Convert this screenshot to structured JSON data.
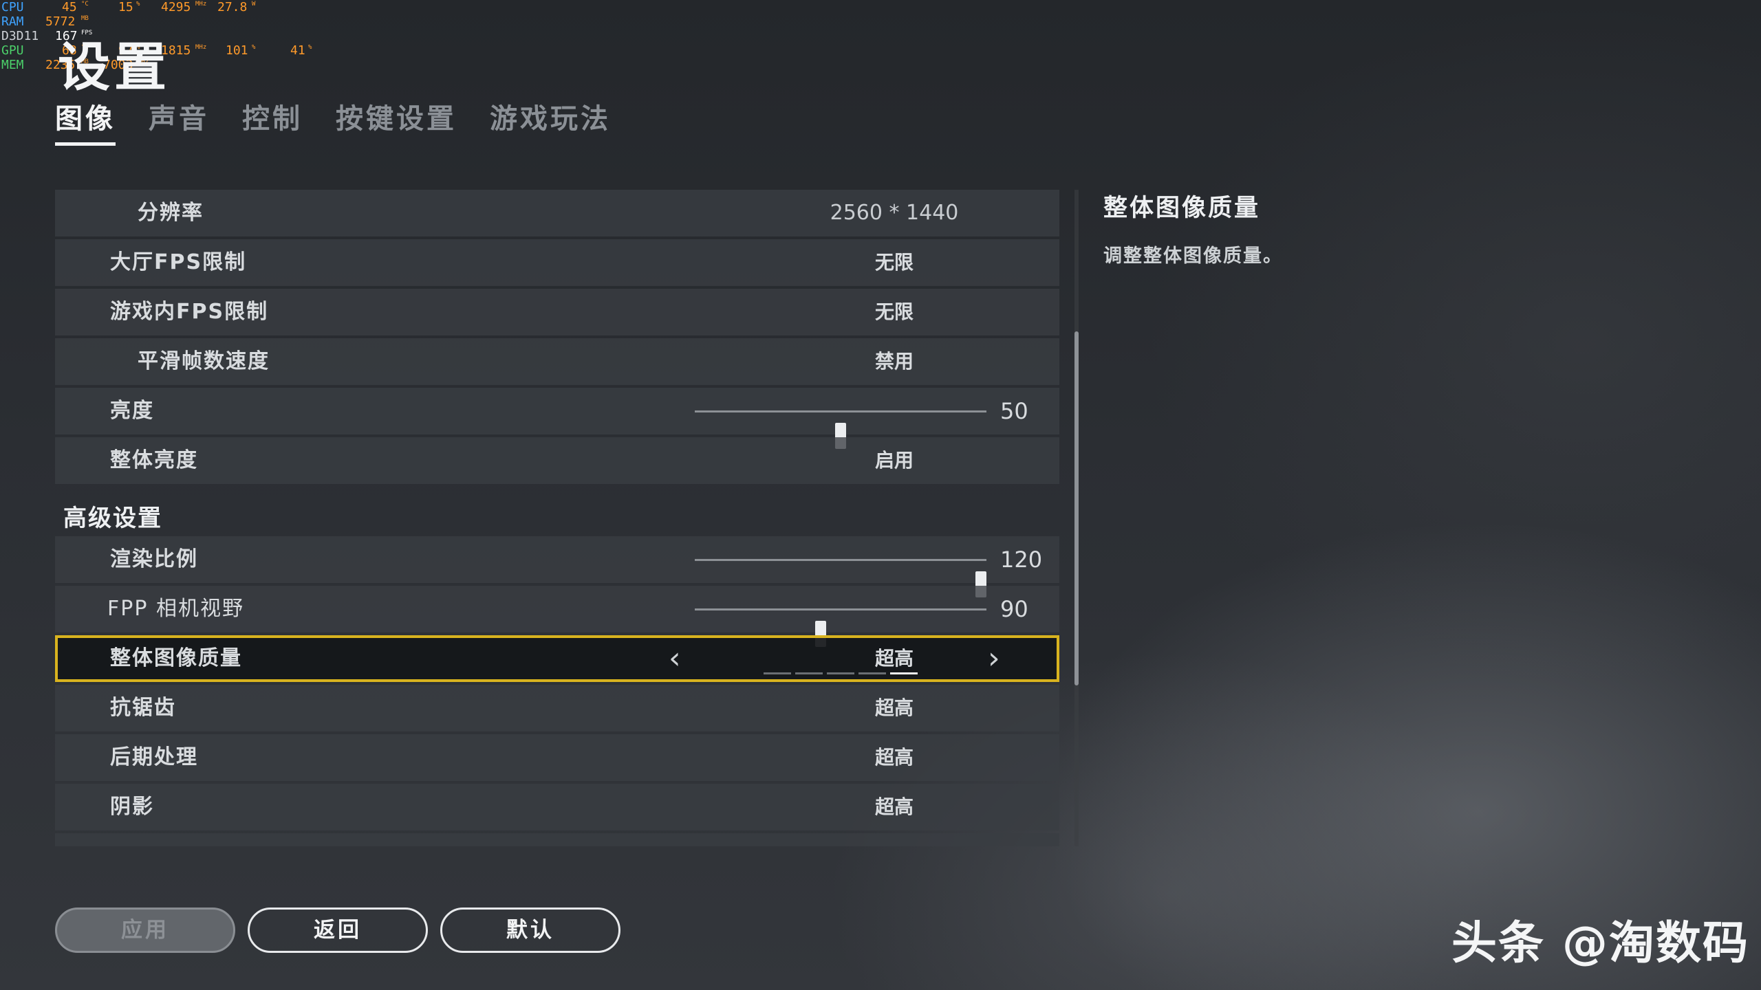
{
  "overlay": {
    "cpu": {
      "label": "CPU",
      "temp": "45",
      "temp_unit": "°C",
      "load": "15",
      "load_unit": "%",
      "clock": "4295",
      "clock_unit": "MHz",
      "power": "27.8",
      "power_unit": "W"
    },
    "ram": {
      "label": "RAM",
      "used": "5772",
      "used_unit": "MB"
    },
    "d3d": {
      "label": "D3D11",
      "fps": "167",
      "fps_unit": "FPS"
    },
    "gpu": {
      "label": "GPU",
      "temp": "68",
      "temp_unit": "°C",
      "load": "97",
      "load_unit": "%",
      "clock": "1815",
      "clock_unit": "MHz",
      "power": "101",
      "power_unit": "%",
      "fan": "41",
      "fan_unit": "%"
    },
    "mem": {
      "label": "MEM",
      "used": "2235",
      "used_unit": "MB",
      "clock": "7003",
      "clock_unit": "MHz"
    }
  },
  "page": {
    "title": "设置"
  },
  "tabs": [
    {
      "label": "图像",
      "active": true
    },
    {
      "label": "声音",
      "active": false
    },
    {
      "label": "控制",
      "active": false
    },
    {
      "label": "按键设置",
      "active": false
    },
    {
      "label": "游戏玩法",
      "active": false
    }
  ],
  "settings": {
    "resolution": {
      "label": "分辨率",
      "value": "2560 * 1440"
    },
    "lobby_fps": {
      "label": "大厅FPS限制",
      "value": "无限"
    },
    "ingame_fps": {
      "label": "游戏内FPS限制",
      "value": "无限"
    },
    "smooth_frame": {
      "label": "平滑帧数速度",
      "value": "禁用"
    },
    "brightness": {
      "label": "亮度",
      "value": "50",
      "level": 0.5
    },
    "overall_brightness": {
      "label": "整体亮度",
      "value": "启用"
    },
    "advanced_section": "高级设置",
    "render_scale": {
      "label": "渲染比例",
      "value": "120",
      "level": 1.0
    },
    "fpp_fov": {
      "label": "FPP 相机视野",
      "value": "90",
      "level": 0.43
    },
    "overall_quality": {
      "label": "整体图像质量",
      "value": "超高",
      "prev_icon": "chevron-left",
      "next_icon": "chevron-right",
      "steps": 5,
      "current_step": 5
    },
    "anti_aliasing": {
      "label": "抗锯齿",
      "value": "超高"
    },
    "post_processing": {
      "label": "后期处理",
      "value": "超高"
    },
    "shadows": {
      "label": "阴影",
      "value": "超高"
    }
  },
  "description": {
    "title": "整体图像质量",
    "text": "调整整体图像质量。"
  },
  "buttons": {
    "apply": "应用",
    "back": "返回",
    "default": "默认"
  },
  "watermark": "头条 @淘数码",
  "colors": {
    "selected_border": "#d8b31f",
    "row_bg": "#3a3d42"
  }
}
